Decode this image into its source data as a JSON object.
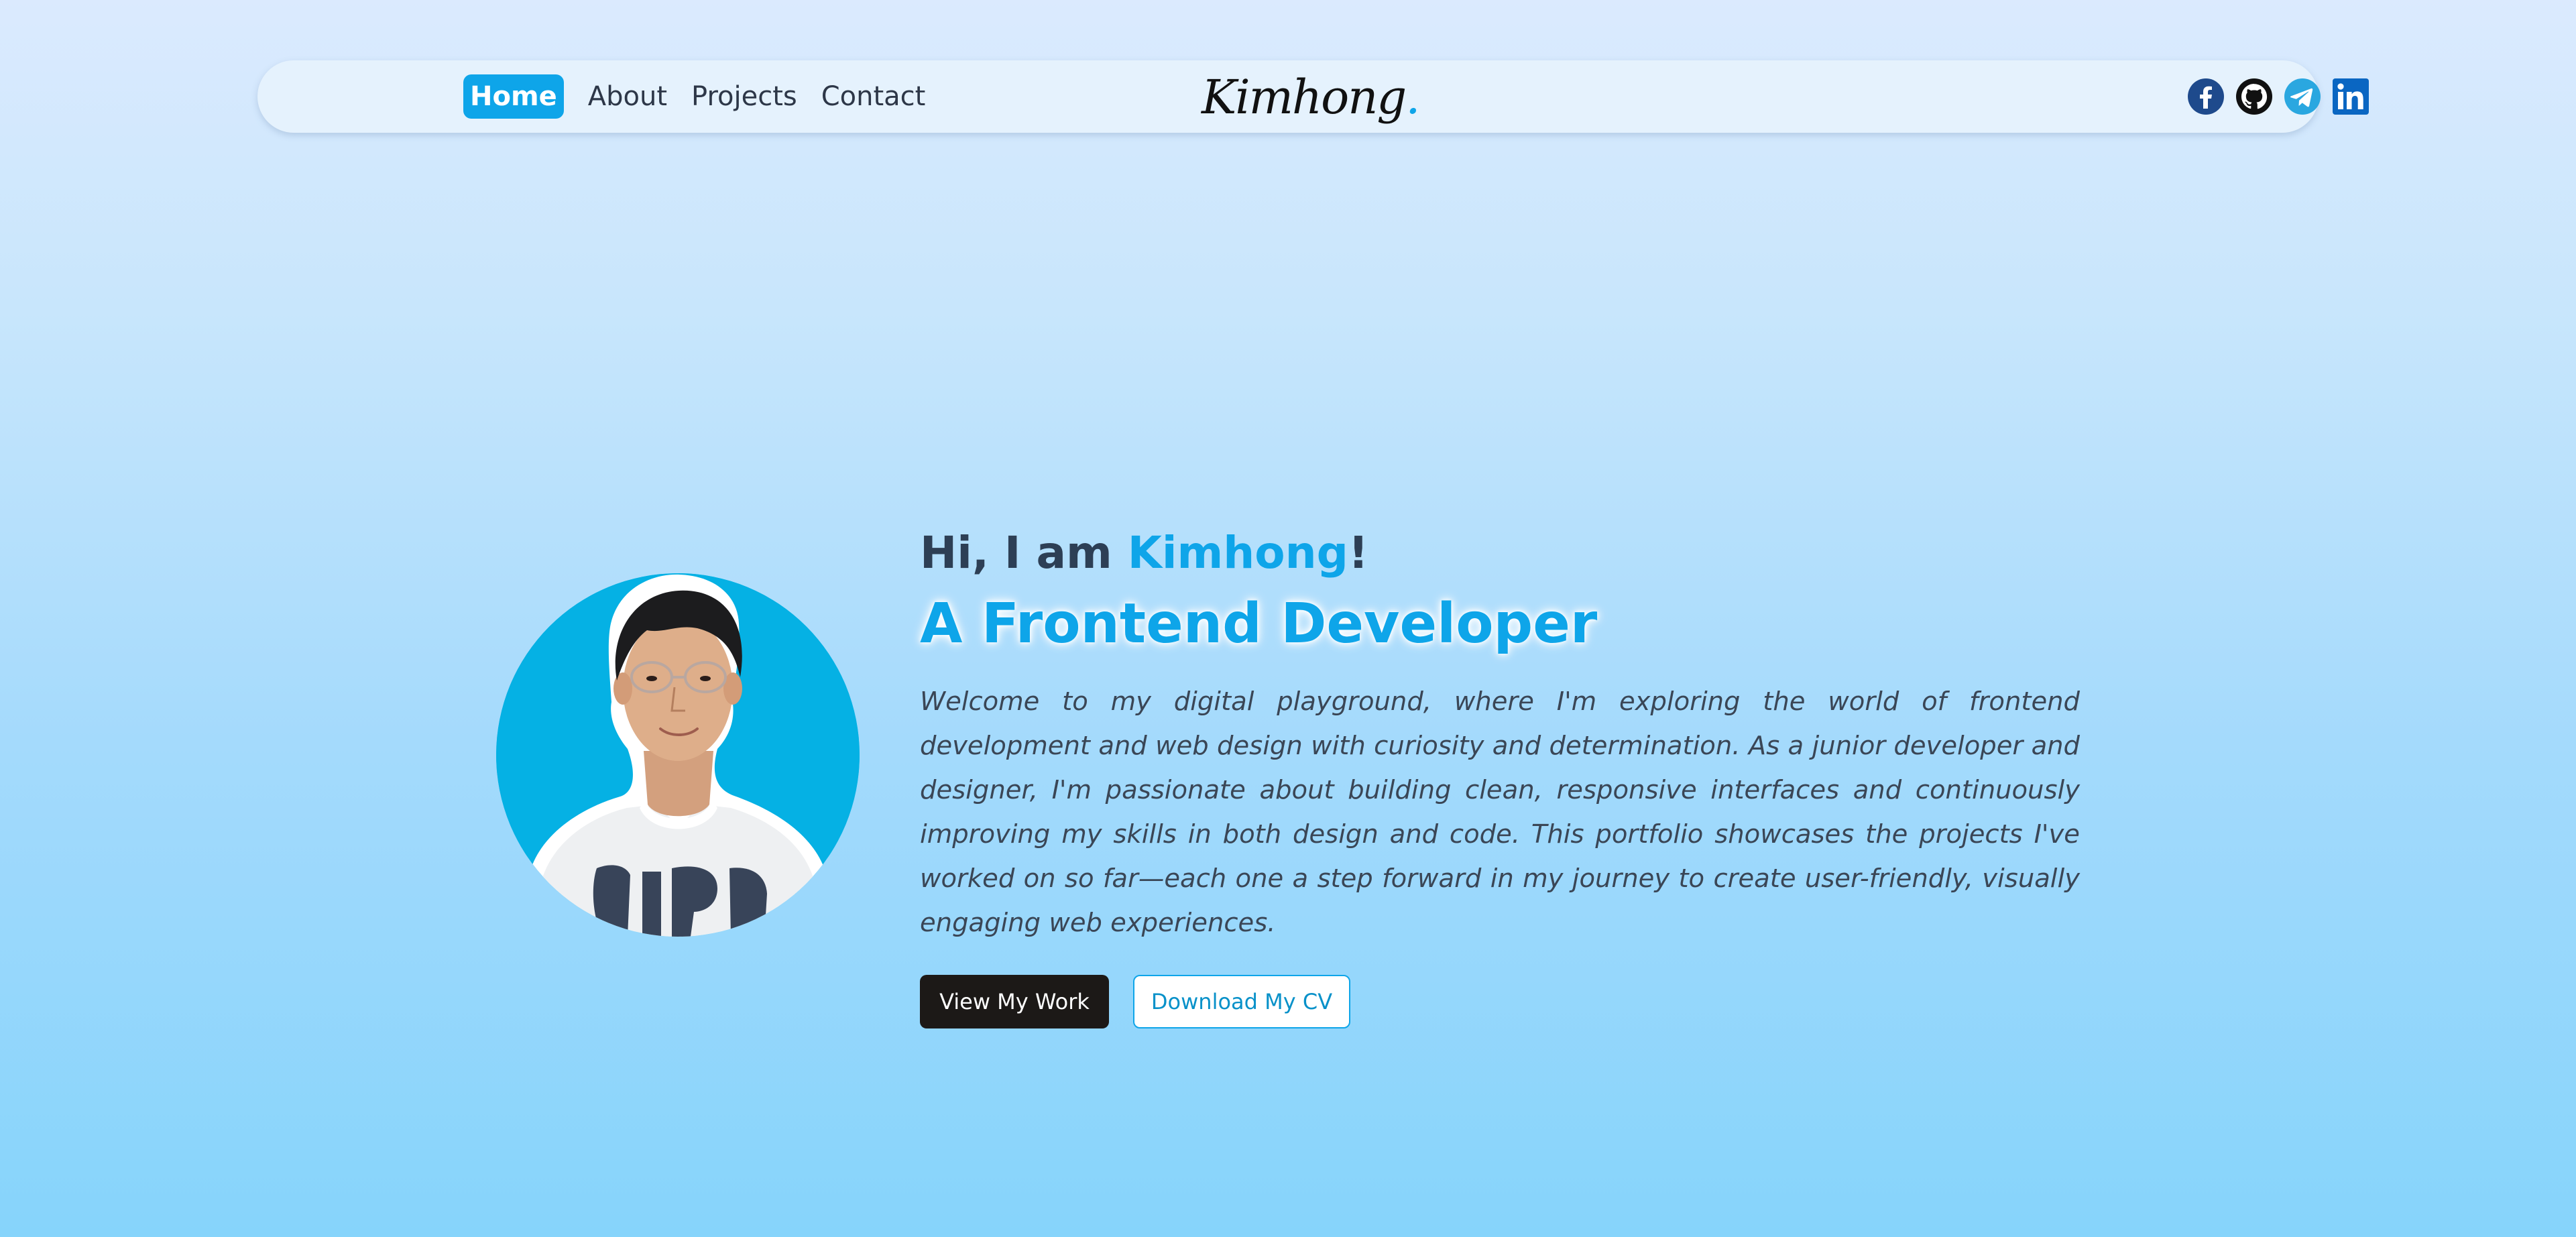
{
  "nav": {
    "links": [
      {
        "label": "Home",
        "active": true
      },
      {
        "label": "About",
        "active": false
      },
      {
        "label": "Projects",
        "active": false
      },
      {
        "label": "Contact",
        "active": false
      }
    ],
    "logo": "Kimhong",
    "logo_dot": ".",
    "social": [
      {
        "name": "facebook-icon",
        "color": "#1e4a8c"
      },
      {
        "name": "github-icon",
        "color": "#111111"
      },
      {
        "name": "telegram-icon",
        "color": "#2aa7e0"
      },
      {
        "name": "linkedin-icon",
        "color": "#0a66c2"
      }
    ]
  },
  "hero": {
    "greeting_prefix": "Hi, I am ",
    "name": "Kimhong",
    "greeting_suffix": "!",
    "role": "A Frontend Developer",
    "intro": "Welcome to my digital playground, where I'm exploring the world of frontend development and web design with curiosity and determination. As a junior developer and designer, I'm passionate about building clean, responsive interfaces and continuously improving my skills in both design and code. This portfolio showcases the projects I've worked on so far—each one a step forward in my journey to create user-friendly, visually engaging web experiences.",
    "primary_button": "View My Work",
    "secondary_button": "Download My CV"
  },
  "colors": {
    "accent": "#0ea5e9",
    "dark_button": "#1c1917",
    "avatar_bg": "#05b1e4"
  }
}
